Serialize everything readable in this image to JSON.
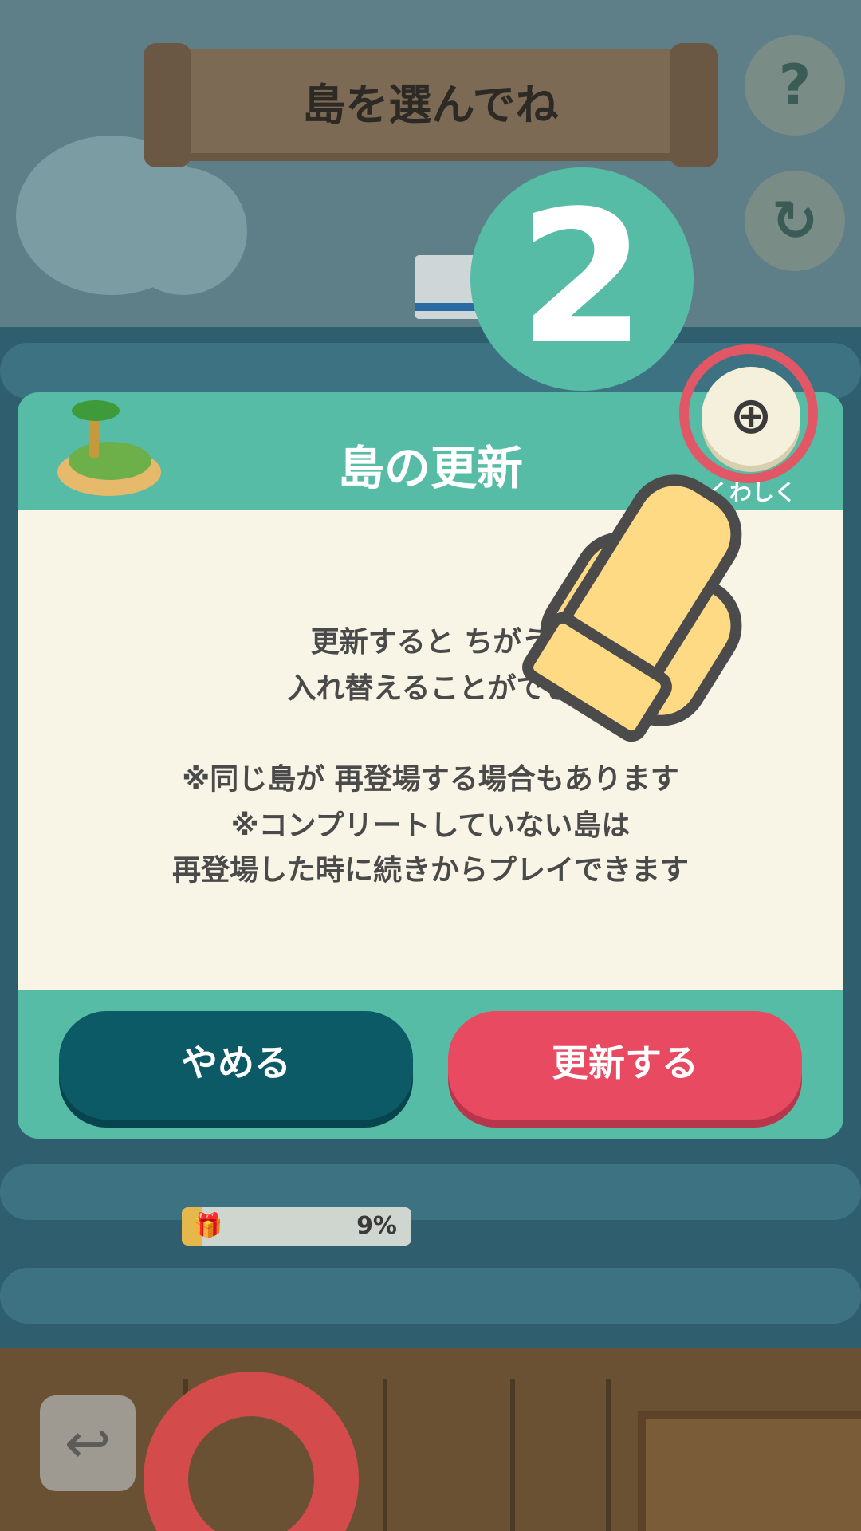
{
  "screen": {
    "title": "島を選んでね",
    "help_icon": "?",
    "refresh_icon": "↻",
    "step_number": "2"
  },
  "dialog": {
    "title": "島の更新",
    "details_icon": "⊕",
    "details_label": "くわしく",
    "message_lines": [
      "更新すると ちがう",
      "入れ替えることができ",
      "",
      "※同じ島が 再登場する場合もあります",
      "※コンプリートしていない島は",
      "再登場した時に続きからプレイできます"
    ],
    "cancel_label": "やめる",
    "update_label": "更新する"
  },
  "island_card": {
    "progress_percent": 9,
    "progress_label": "9%",
    "gift_icon": "🎁"
  },
  "footer": {
    "back_icon": "↩"
  },
  "colors": {
    "accent_teal": "#57bca6",
    "cancel_dark_teal": "#0b5a66",
    "update_red": "#e84a62",
    "highlight_ring": "#e25766"
  }
}
